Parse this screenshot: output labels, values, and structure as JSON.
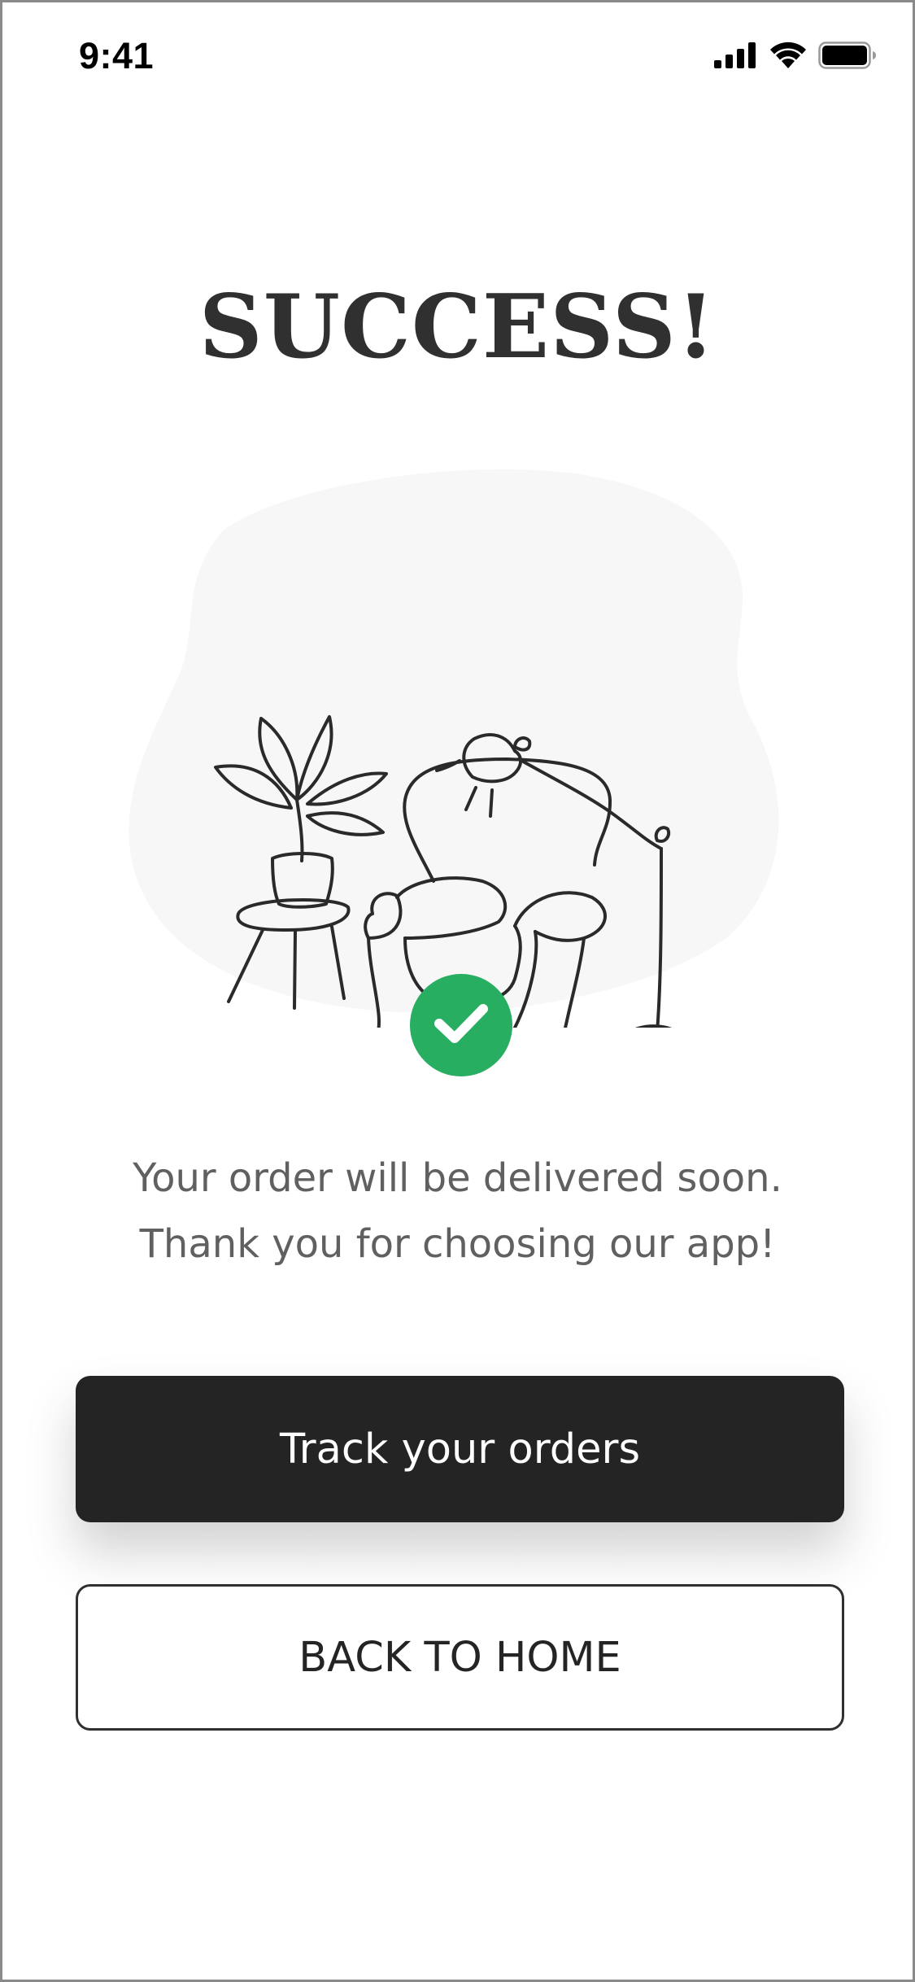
{
  "status_bar": {
    "time": "9:41",
    "icons": [
      "cellular-signal-icon",
      "wifi-icon",
      "battery-icon"
    ]
  },
  "screen": {
    "title": "SUCCESS!",
    "illustration": "furniture-line-art (plant, armchair, floor lamp)",
    "badge_icon": "check-icon",
    "message_line1": "Your order will be delivered soon.",
    "message_line2": "Thank you for choosing our app!"
  },
  "actions": {
    "primary_label": "Track your orders",
    "secondary_label": "BACK TO HOME"
  },
  "colors": {
    "primary_button": "#242424",
    "success_badge": "#27ae60",
    "title_text": "#303030",
    "body_text": "#606060",
    "blob_background": "#f7f7f7"
  }
}
